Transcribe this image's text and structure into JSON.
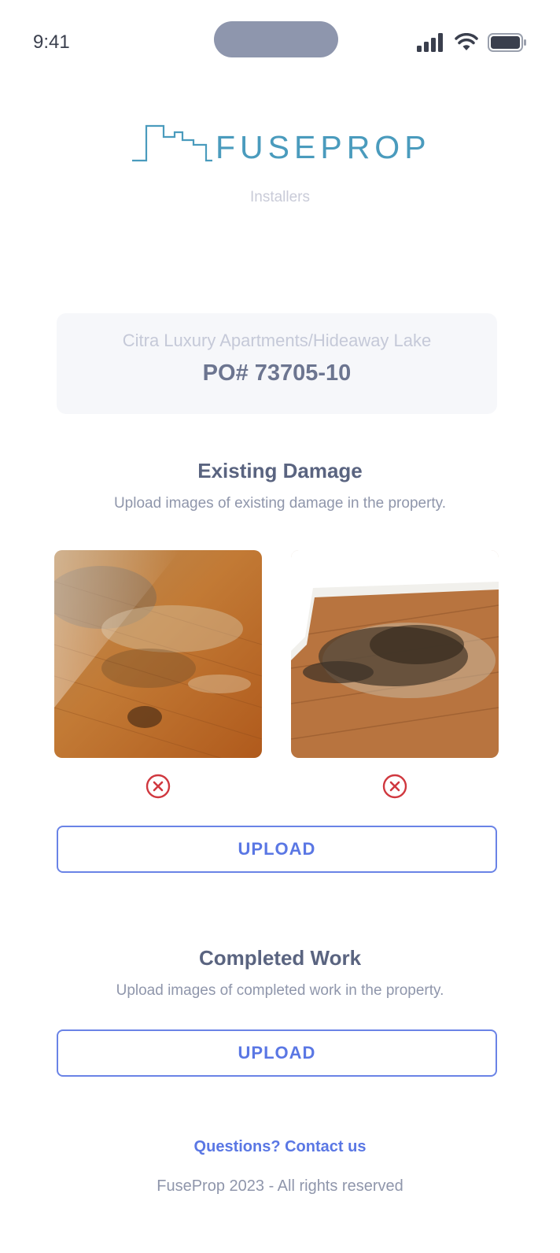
{
  "status_bar": {
    "time": "9:41"
  },
  "brand": {
    "logo_text": "FUSEPROP",
    "subtitle": "Installers"
  },
  "property": {
    "name": "Citra Luxury Apartments/Hideaway Lake",
    "po_number": "PO# 73705-10"
  },
  "existing_damage": {
    "title": "Existing Damage",
    "description": "Upload images of existing damage in the property.",
    "photos": [
      {
        "icon": "damaged-floor-photo-1"
      },
      {
        "icon": "damaged-floor-photo-2"
      }
    ],
    "upload_label": "UPLOAD"
  },
  "completed_work": {
    "title": "Completed Work",
    "description": "Upload images of completed work in the property.",
    "upload_label": "UPLOAD"
  },
  "footer": {
    "contact_label": "Questions? Contact us",
    "copyright": "FuseProp 2023 - All rights reserved"
  },
  "colors": {
    "accent": "#5a77e4",
    "logo": "#4a9bbd",
    "remove": "#d0383f",
    "text": "#5a6480"
  }
}
